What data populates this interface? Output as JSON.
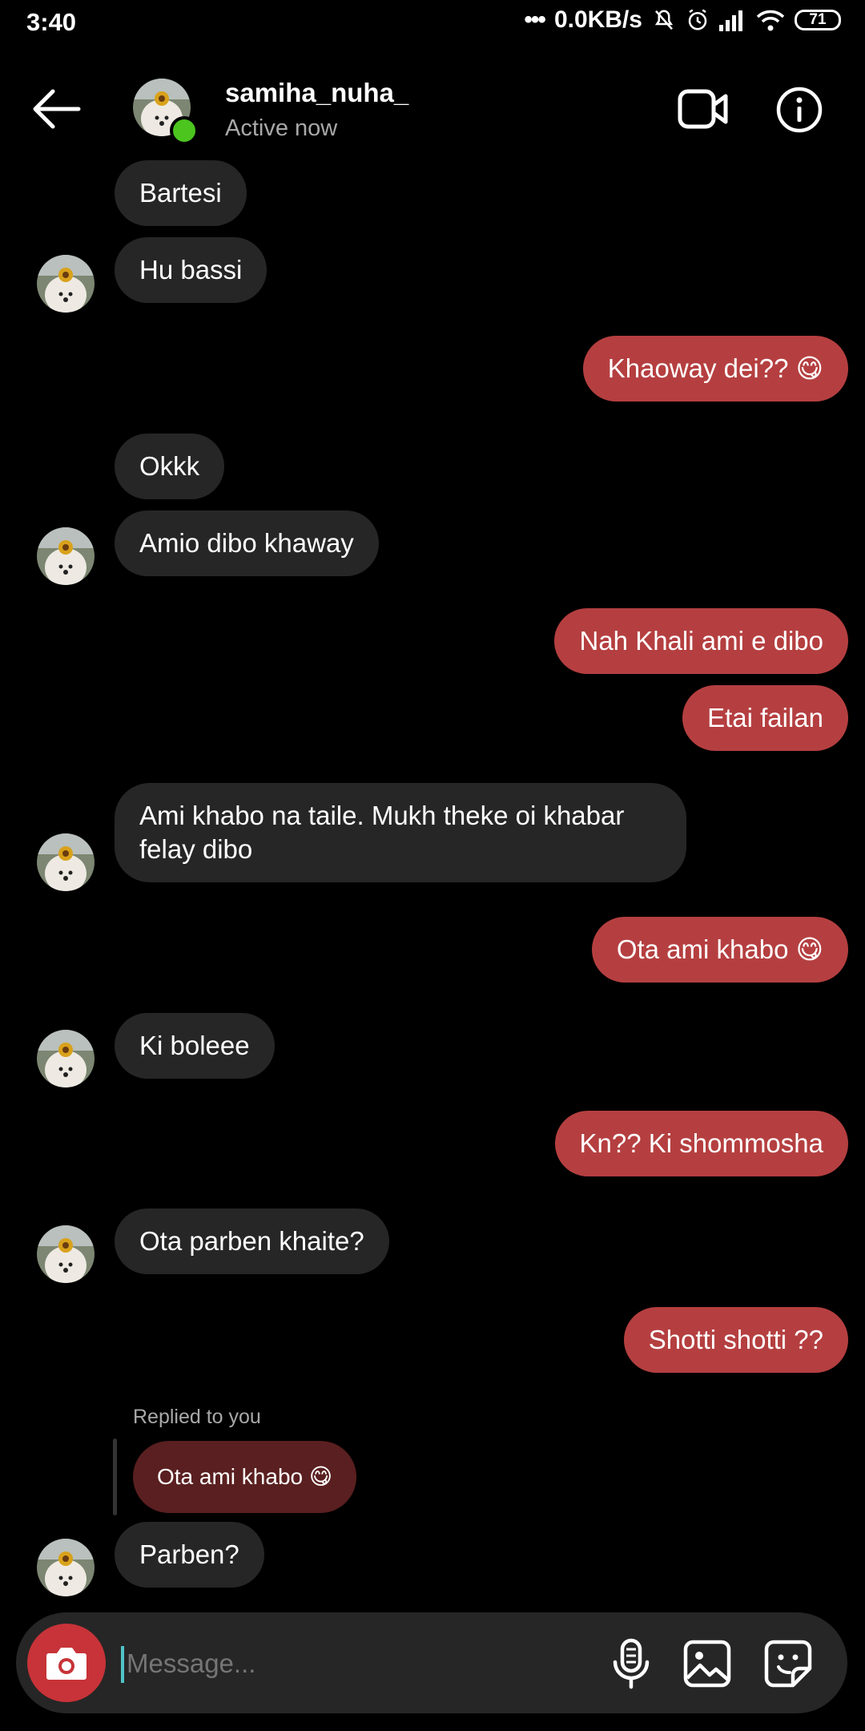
{
  "status_bar": {
    "time": "3:40",
    "network_speed": "0.0KB/s",
    "battery": "71"
  },
  "header": {
    "username": "samiha_nuha_",
    "status": "Active now",
    "icons": [
      "back-arrow-icon",
      "video-call-icon",
      "info-icon"
    ],
    "online_color": "#4cc51f"
  },
  "messages": [
    {
      "from": "them",
      "text": "Bartesi"
    },
    {
      "from": "them",
      "text": "Hu bassi"
    },
    {
      "from": "me",
      "text": "Khaoway dei?? 😋"
    },
    {
      "from": "them",
      "text": "Okkk"
    },
    {
      "from": "them",
      "text": "Amio dibo khaway"
    },
    {
      "from": "me",
      "text": "Nah Khali ami e dibo"
    },
    {
      "from": "me",
      "text": "Etai failan"
    },
    {
      "from": "them",
      "text": "Ami khabo na taile. Mukh theke oi khabar felay dibo"
    },
    {
      "from": "me",
      "text": "Ota ami khabo 😋"
    },
    {
      "from": "them",
      "text": "Ki boleee"
    },
    {
      "from": "me",
      "text": "Kn?? Ki shommosha"
    },
    {
      "from": "them",
      "text": "Ota parben khaite?"
    },
    {
      "from": "me",
      "text": "Shotti shotti ??"
    },
    {
      "from": "them",
      "text": "Parben?"
    }
  ],
  "reply": {
    "label": "Replied to you",
    "quoted_text": "Ota ami khabo 😋"
  },
  "composer": {
    "placeholder": "Message...",
    "icons": [
      "camera-icon",
      "microphone-icon",
      "gallery-icon",
      "sticker-icon"
    ]
  },
  "colors": {
    "background": "#000000",
    "incoming_bubble": "#262626",
    "outgoing_bubble": "#b53f40",
    "camera_button": "#c73338"
  }
}
